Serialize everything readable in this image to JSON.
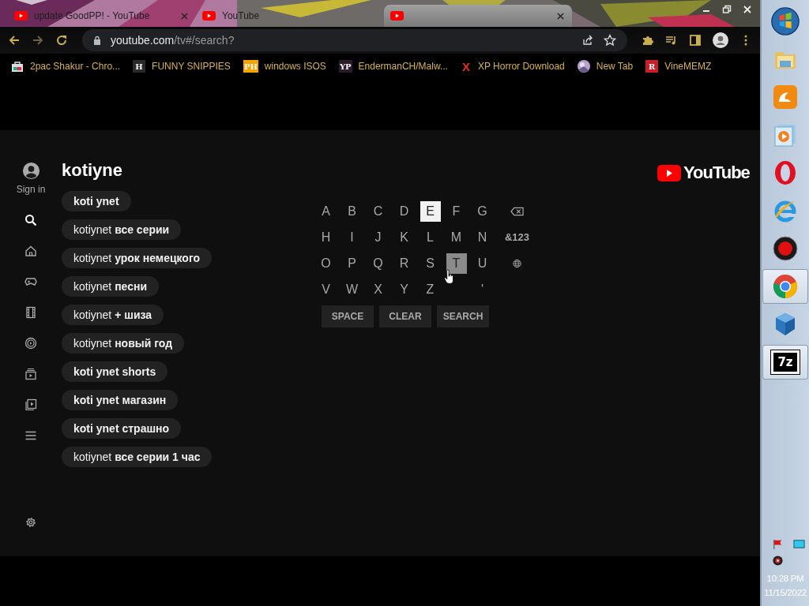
{
  "browser": {
    "tabs": [
      {
        "title": "update GoodPP! - YouTube",
        "selected": false,
        "closable": true
      },
      {
        "title": "YouTube",
        "selected": false,
        "closable": false
      },
      {
        "selected": true,
        "closable": true
      }
    ],
    "address": {
      "host": "youtube.com",
      "path": "/tv#/search?"
    },
    "bookmarks": [
      {
        "kind": "bag",
        "label": "2pac Shakur - Chro..."
      },
      {
        "kind": "badge",
        "badge": "H",
        "color": "#2a2a2a",
        "label": "FUNNY SNIPPIES"
      },
      {
        "kind": "badge",
        "badge": "PH",
        "color": "#f7a400",
        "label": "windows ISOS"
      },
      {
        "kind": "badge",
        "badge": "YP",
        "color": "#2b1b2b",
        "label": "EndermanCH/Malw..."
      },
      {
        "kind": "mark",
        "badge": "X",
        "color": "#e53020",
        "label": "XP Horror Download"
      },
      {
        "kind": "globe",
        "label": "New Tab"
      },
      {
        "kind": "badge",
        "badge": "R",
        "color": "#c81e2a",
        "label": "VineMEMZ"
      }
    ]
  },
  "sidebar": {
    "sign_in": "Sign in",
    "items": [
      {
        "kind": "search",
        "selected": true
      },
      {
        "kind": "home",
        "selected": false
      },
      {
        "kind": "gaming",
        "selected": false
      },
      {
        "kind": "movies",
        "selected": false
      },
      {
        "kind": "live",
        "selected": false
      },
      {
        "kind": "subscriptions",
        "selected": false
      },
      {
        "kind": "library",
        "selected": false
      },
      {
        "kind": "menu",
        "selected": false
      }
    ]
  },
  "query": "kotiyne",
  "logo": "YouTube",
  "suggestions": [
    {
      "text": "koti ynet",
      "bold": true
    },
    {
      "text": "kotiynet **все серии**",
      "bold": false
    },
    {
      "text": "kotiynet **урок немецкого**",
      "bold": false
    },
    {
      "text": "kotiynet **песни**",
      "bold": false
    },
    {
      "text": "kotiynet **+ шиза**",
      "bold": false
    },
    {
      "text": "kotiynet **новый год**",
      "bold": false
    },
    {
      "text": "koti ynet shorts",
      "bold": true
    },
    {
      "text": "koti ynet магазин",
      "bold": true
    },
    {
      "text": "koti ynet страшно",
      "bold": true
    },
    {
      "text": "kotiynet **все серии 1 час**",
      "bold": false
    }
  ],
  "keyboard": {
    "rows": [
      [
        {
          "kind": "letter",
          "label": "A",
          "selected": false,
          "hovered": false
        },
        {
          "kind": "letter",
          "label": "B",
          "selected": false,
          "hovered": false
        },
        {
          "kind": "letter",
          "label": "C",
          "selected": false,
          "hovered": false
        },
        {
          "kind": "letter",
          "label": "D",
          "selected": false,
          "hovered": false
        },
        {
          "kind": "letter",
          "label": "E",
          "selected": true,
          "hovered": false
        },
        {
          "kind": "letter",
          "label": "F",
          "selected": false,
          "hovered": false
        },
        {
          "kind": "letter",
          "label": "G",
          "selected": false,
          "hovered": false
        },
        {
          "kind": "backspace",
          "selected": false,
          "hovered": false
        }
      ],
      [
        {
          "kind": "letter",
          "label": "H",
          "selected": false,
          "hovered": false
        },
        {
          "kind": "letter",
          "label": "I",
          "selected": false,
          "hovered": false
        },
        {
          "kind": "letter",
          "label": "J",
          "selected": false,
          "hovered": false
        },
        {
          "kind": "letter",
          "label": "K",
          "selected": false,
          "hovered": false
        },
        {
          "kind": "letter",
          "label": "L",
          "selected": false,
          "hovered": false
        },
        {
          "kind": "letter",
          "label": "M",
          "selected": false,
          "hovered": false
        },
        {
          "kind": "letter",
          "label": "N",
          "selected": false,
          "hovered": false
        },
        {
          "kind": "symbols",
          "label": "&123",
          "selected": false,
          "hovered": false
        }
      ],
      [
        {
          "kind": "letter",
          "label": "O",
          "selected": false,
          "hovered": false
        },
        {
          "kind": "letter",
          "label": "P",
          "selected": false,
          "hovered": false
        },
        {
          "kind": "letter",
          "label": "Q",
          "selected": false,
          "hovered": false
        },
        {
          "kind": "letter",
          "label": "R",
          "selected": false,
          "hovered": false
        },
        {
          "kind": "letter",
          "label": "S",
          "selected": false,
          "hovered": false
        },
        {
          "kind": "letter",
          "label": "T",
          "selected": false,
          "hovered": true
        },
        {
          "kind": "letter",
          "label": "U",
          "selected": false,
          "hovered": false
        },
        {
          "kind": "globe",
          "selected": false,
          "hovered": false
        }
      ],
      [
        {
          "kind": "letter",
          "label": "V",
          "selected": false,
          "hovered": false
        },
        {
          "kind": "letter",
          "label": "W",
          "selected": false,
          "hovered": false
        },
        {
          "kind": "letter",
          "label": "X",
          "selected": false,
          "hovered": false
        },
        {
          "kind": "letter",
          "label": "Y",
          "selected": false,
          "hovered": false
        },
        {
          "kind": "letter",
          "label": "Z",
          "selected": false,
          "hovered": false
        },
        {
          "kind": "blank"
        },
        {
          "kind": "letter",
          "label": "'",
          "selected": false,
          "hovered": false
        }
      ]
    ],
    "buttons": [
      "SPACE",
      "CLEAR",
      "SEARCH"
    ]
  },
  "taskbar": {
    "apps": [
      {
        "kind": "folder",
        "active": false
      },
      {
        "kind": "uc",
        "active": false
      },
      {
        "kind": "player",
        "active": false
      },
      {
        "kind": "opera",
        "active": false
      },
      {
        "kind": "ie",
        "active": false
      },
      {
        "kind": "recorder",
        "active": false
      },
      {
        "kind": "chrome",
        "active": true
      },
      {
        "kind": "cube",
        "active": false
      },
      {
        "kind": "archiver",
        "label": "7z",
        "active": true
      }
    ],
    "time": "10:28 PM",
    "date": "11/15/2022"
  }
}
